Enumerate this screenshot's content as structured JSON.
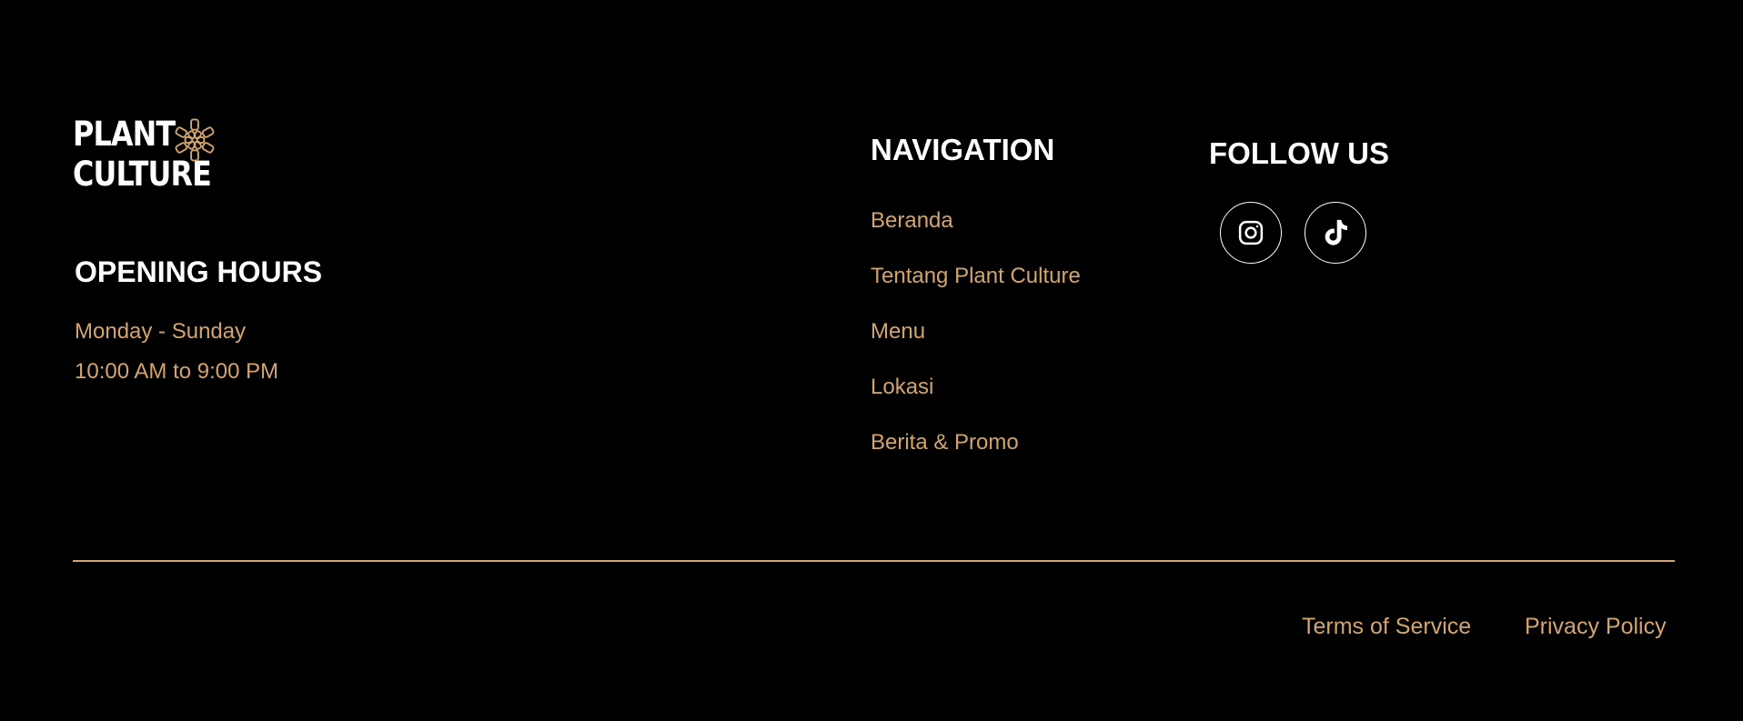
{
  "brand": {
    "logo_line1": "PLANT",
    "logo_line2": "CULTURE",
    "accent_color": "#d3a46e",
    "logo_mark_icon": "flower-mandala-icon"
  },
  "opening_hours": {
    "title": "OPENING HOURS",
    "days": "Monday - Sunday",
    "time": "10:00 AM to 9:00 PM"
  },
  "navigation": {
    "title": "NAVIGATION",
    "items": [
      {
        "label": "Beranda"
      },
      {
        "label": "Tentang Plant Culture"
      },
      {
        "label": "Menu"
      },
      {
        "label": "Lokasi"
      },
      {
        "label": "Berita & Promo"
      }
    ]
  },
  "follow_us": {
    "title": "FOLLOW US",
    "icons": [
      "instagram-icon",
      "tiktok-icon"
    ]
  },
  "legal": {
    "terms": "Terms of Service",
    "privacy": "Privacy Policy"
  }
}
